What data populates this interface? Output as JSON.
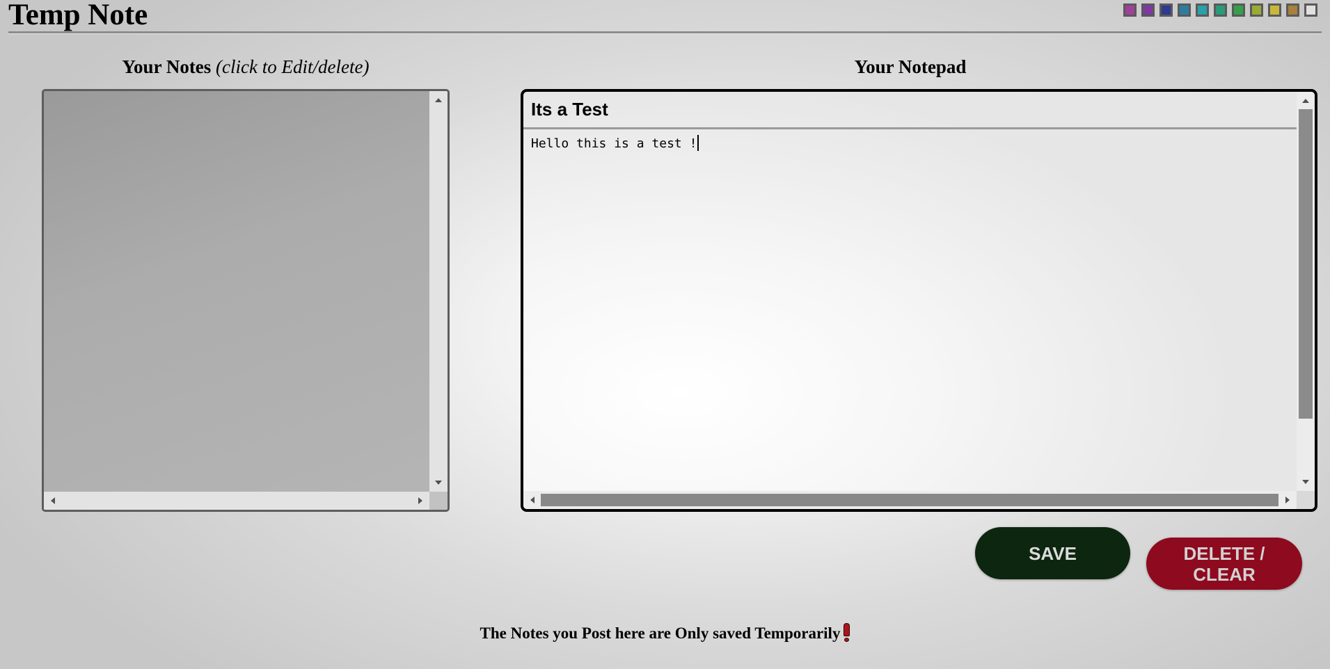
{
  "header": {
    "title": "Temp Note",
    "theme_swatches": [
      {
        "name": "swatch-magenta",
        "color": "#a0409a"
      },
      {
        "name": "swatch-purple",
        "color": "#7d3aa0"
      },
      {
        "name": "swatch-navy",
        "color": "#2e3a8e"
      },
      {
        "name": "swatch-steel-blue",
        "color": "#2e7da0"
      },
      {
        "name": "swatch-teal",
        "color": "#2aa0a8"
      },
      {
        "name": "swatch-sea-green",
        "color": "#2a9a78"
      },
      {
        "name": "swatch-green",
        "color": "#35a04a"
      },
      {
        "name": "swatch-olive",
        "color": "#9aaa35"
      },
      {
        "name": "swatch-mustard",
        "color": "#c8b83a"
      },
      {
        "name": "swatch-brown",
        "color": "#a8803a"
      },
      {
        "name": "swatch-light-gray",
        "color": "#e0e0e0"
      }
    ]
  },
  "notes_panel": {
    "heading": "Your Notes",
    "subheading": "(click to Edit/delete)",
    "items": []
  },
  "notepad": {
    "heading": "Your Notepad",
    "title_value": "Its a Test",
    "body_value": "Hello this is a test !"
  },
  "actions": {
    "save_label": "SAVE",
    "delete_label": "DELETE /\nCLEAR"
  },
  "footer": {
    "note": "The Notes you Post here are Only saved Temporarily"
  },
  "colors": {
    "save_button": "#0d260f",
    "delete_button": "#8e0a1f"
  }
}
